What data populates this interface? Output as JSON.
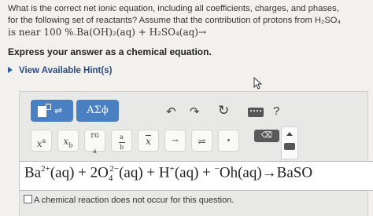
{
  "question": {
    "line1": "What is the correct net ionic equation, including all coefficients, charges, and phases,",
    "line2": "for the following set of reactants? Assume that the contribution of protons from H₂SO₄",
    "line3": "is near 100 %.Ba(OH)₂(aq) + H₂SO₄(aq)→"
  },
  "instruction": "Express your answer as a chemical equation.",
  "hints_label": "View Available Hint(s)",
  "toolbar": {
    "greek_label": "AΣϕ",
    "undo_glyph": "↶",
    "redo_glyph": "↷",
    "reset_glyph": "↻",
    "help_glyph": "?"
  },
  "keypad": {
    "superscript": "x",
    "superscript_exp": "a",
    "subscript": "x",
    "subscript_idx": "b",
    "partial_top": "rɢ",
    "a_label": "a",
    "frac_num": "a",
    "frac_den": "b",
    "bar_label": "x",
    "arrow": "→",
    "equilibrium": "⇌",
    "dot": "•",
    "delete": "⌫"
  },
  "answer": {
    "part1": "Ba",
    "sup1": "2+",
    "part2": "(aq) + 2O",
    "sub2": "4",
    "sup2": "2−",
    "part3": "(aq) + H",
    "sup3": "+",
    "part4": "(aq) + ",
    "sup4": "−",
    "part5": "Oh(aq)→BaSO"
  },
  "no_reaction_label": "A chemical reaction does not occur for this question."
}
